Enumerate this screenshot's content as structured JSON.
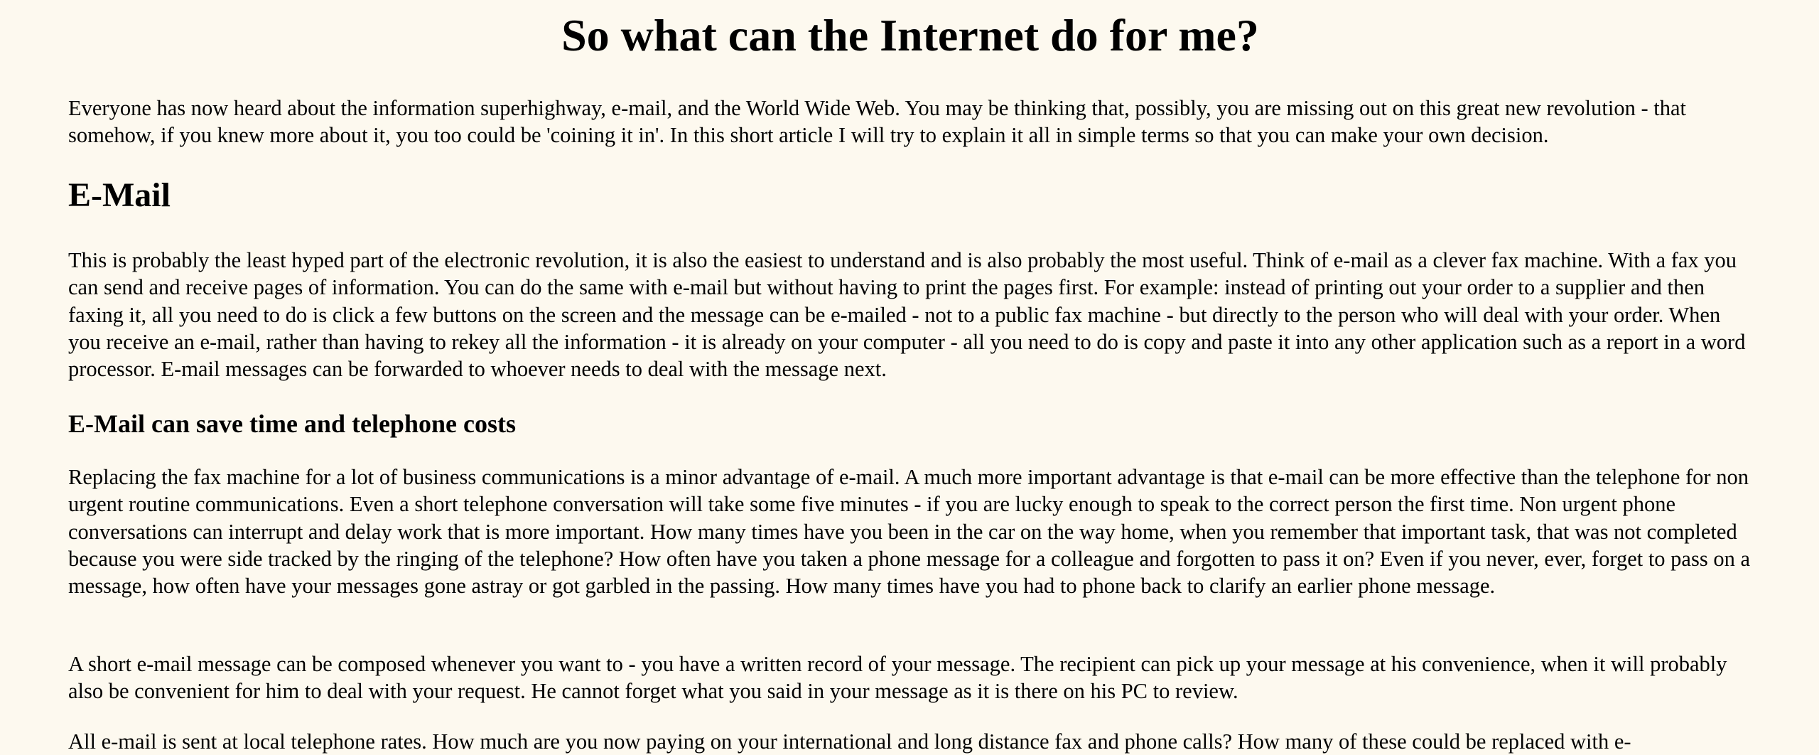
{
  "page": {
    "title": "So what can the Internet do for me?",
    "intro": "Everyone has now heard about the information superhighway, e-mail, and the World Wide Web. You may be thinking that, possibly, you are missing out on this great new revolution - that somehow, if you knew more about it, you too could be 'coining it in'. In this short article I will try to explain it all in simple terms so that you can make your own decision.",
    "sections": [
      {
        "heading": "E-Mail",
        "paragraph": "This is probably the least hyped part of the electronic revolution, it is also the easiest to understand and is also probably the most useful. Think of e-mail as a clever fax machine. With a fax you can send and receive pages of information. You can do the same with e-mail but without having to print the pages first. For example: instead of printing out your order to a supplier and then faxing it, all you need to do is click a few buttons on the screen and the message can be e-mailed - not to a public fax machine - but directly to the person who will deal with your order. When you receive an e-mail, rather than having to rekey all the information - it is already on your computer - all you need to do is copy and paste it into any other application such as a report in a word processor. E-mail messages can be forwarded to whoever needs to deal with the message next."
      },
      {
        "heading": "E-Mail can save time and telephone costs",
        "paragraphs": [
          "Replacing the fax machine for a lot of business communications is a minor advantage of e-mail. A much more important advantage is that e-mail can be more effective than the telephone for non urgent routine communications. Even a short telephone conversation will take some five minutes - if you are lucky enough to speak to the correct person the first time. Non urgent phone conversations can interrupt and delay work that is more important. How many times have you been in the car on the way home, when you remember that important task, that was not completed because you were side tracked by the ringing of the telephone? How often have you taken a phone message for a colleague and forgotten to pass it on? Even if you never, ever, forget to pass on a message, how often have your messages gone astray or got garbled in the passing. How many times have you had to phone back to clarify an earlier phone message.",
          "A short e-mail message can be composed whenever you want to - you have a written record of your message. The recipient can pick up your message at his convenience, when it will probably also be convenient for him to deal with your request. He cannot forget what you said in your message as it is there on his PC to review.",
          "All e-mail is sent at local telephone rates. How much are you now paying on your international and long distance fax and phone calls? How many of these could be replaced with e-"
        ]
      }
    ]
  }
}
